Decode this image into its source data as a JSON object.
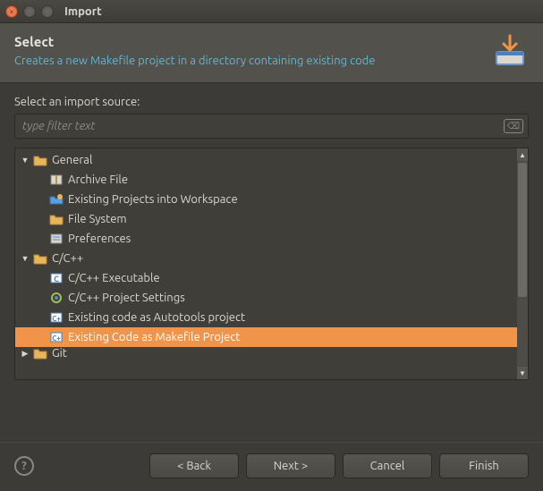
{
  "window": {
    "title": "Import"
  },
  "banner": {
    "heading": "Select",
    "sub": "Creates a new Makefile project in a directory containing existing code"
  },
  "filter": {
    "label": "Select an import source:",
    "placeholder": "type filter text",
    "value": ""
  },
  "tree": {
    "groups": [
      {
        "label": "General",
        "expanded": true,
        "items": [
          {
            "label": "Archive File",
            "icon": "archive"
          },
          {
            "label": "Existing Projects into Workspace",
            "icon": "projects"
          },
          {
            "label": "File System",
            "icon": "folder"
          },
          {
            "label": "Preferences",
            "icon": "prefs"
          }
        ]
      },
      {
        "label": "C/C++",
        "expanded": true,
        "items": [
          {
            "label": "C/C++ Executable",
            "icon": "c-exec"
          },
          {
            "label": "C/C++ Project Settings",
            "icon": "c-settings"
          },
          {
            "label": "Existing code as Autotools project",
            "icon": "c-proj"
          },
          {
            "label": "Existing Code as Makefile Project",
            "icon": "c-proj",
            "selected": true
          }
        ]
      },
      {
        "label": "Git",
        "expanded": false,
        "items": [],
        "cut": true
      }
    ]
  },
  "buttons": {
    "back": "< Back",
    "next": "Next >",
    "cancel": "Cancel",
    "finish": "Finish"
  }
}
